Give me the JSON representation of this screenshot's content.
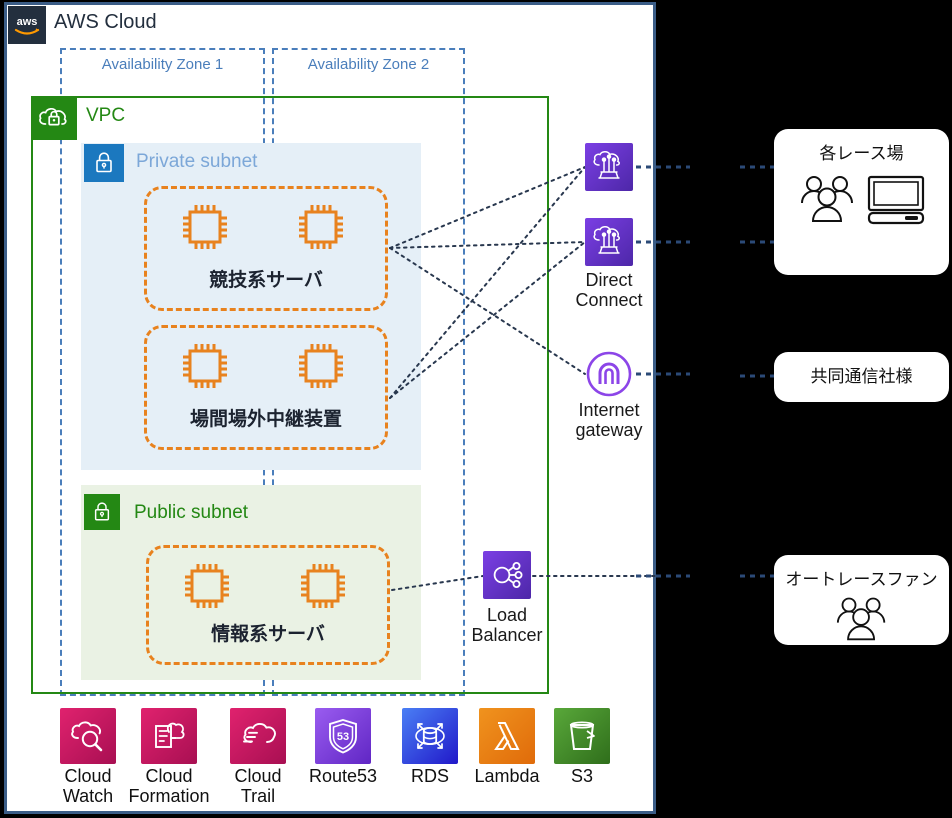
{
  "cloud": {
    "title": "AWS Cloud",
    "logo_icon": "aws-logo-icon",
    "border_color": "#3b5d87"
  },
  "availability_zones": [
    {
      "label": "Availability Zone 1"
    },
    {
      "label": "Availability Zone 2"
    }
  ],
  "vpc": {
    "label": "VPC",
    "icon": "vpc-cloud-lock-icon",
    "color": "#248814"
  },
  "subnets": [
    {
      "label": "Private subnet",
      "icon": "lock-icon",
      "icon_color": "#1b78bf",
      "fill": "#e5eff7",
      "label_color": "#7ca7d8",
      "groups": [
        {
          "caption": "競技系サーバ",
          "instances": 2,
          "icon": "server-chip-icon"
        },
        {
          "caption": "場間場外中継装置",
          "instances": 2,
          "icon": "server-chip-icon"
        }
      ]
    },
    {
      "label": "Public subnet",
      "icon": "lock-icon",
      "icon_color": "#248814",
      "fill": "#eaf2e4",
      "label_color": "#248814",
      "groups": [
        {
          "caption": "情報系サーバ",
          "instances": 2,
          "icon": "server-chip-icon"
        }
      ]
    }
  ],
  "edge_services": [
    {
      "name": "direct-connect-1",
      "label": "",
      "icon": "direct-connect-icon",
      "color": "#7b3fe4"
    },
    {
      "name": "direct-connect-2",
      "label": "Direct\nConnect",
      "icon": "direct-connect-icon",
      "color": "#7b3fe4"
    },
    {
      "name": "internet-gateway",
      "label": "Internet\ngateway",
      "icon": "internet-gateway-icon",
      "color": "#7b3fe4"
    },
    {
      "name": "load-balancer",
      "label": "Load\nBalancer",
      "icon": "load-balancer-icon",
      "color": "#7b3fe4"
    }
  ],
  "edge_labels": {
    "direct_connect": "Direct\nConnect",
    "internet_gateway": "Internet\ngateway",
    "load_balancer": "Load\nBalancer"
  },
  "external_entities": [
    {
      "title": "各レース場",
      "icons": [
        "users-icon",
        "monitor-icon"
      ]
    },
    {
      "title": "共同通信社様",
      "icons": []
    },
    {
      "title": "オートレースファン",
      "icons": [
        "users-icon"
      ]
    }
  ],
  "bottom_services": [
    {
      "label": "Cloud\nWatch",
      "icon": "cloudwatch-icon",
      "color": "#c9176b"
    },
    {
      "label": "Cloud\nFormation",
      "icon": "cloudformation-icon",
      "color": "#c9176b"
    },
    {
      "label": "Cloud\nTrail",
      "icon": "cloudtrail-icon",
      "color": "#c9176b"
    },
    {
      "label": "Route53",
      "icon": "route53-icon",
      "color": "#7b3fe4"
    },
    {
      "label": "RDS",
      "icon": "rds-icon",
      "color": "#2f5ee0"
    },
    {
      "label": "Lambda",
      "icon": "lambda-icon",
      "color": "#ec7211"
    },
    {
      "label": "S3",
      "icon": "s3-icon",
      "color": "#3f8624"
    }
  ]
}
